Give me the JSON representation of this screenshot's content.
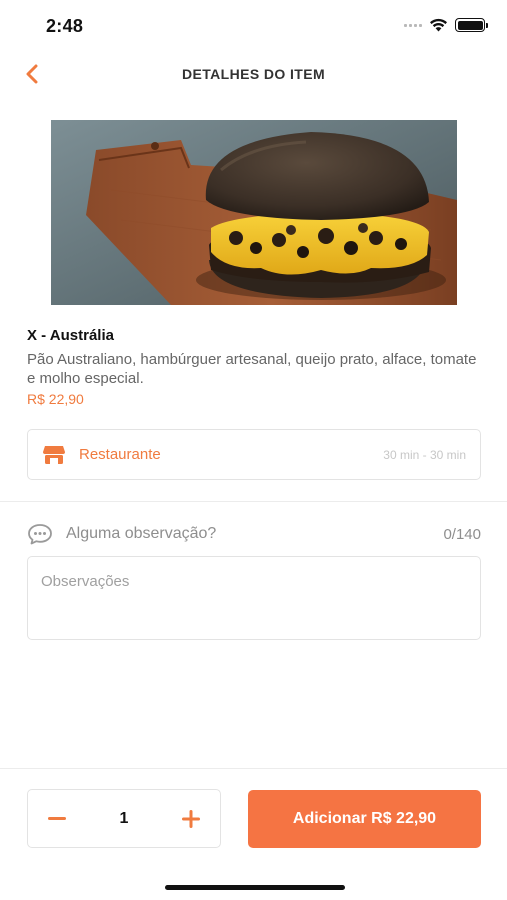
{
  "status_bar": {
    "time": "2:48"
  },
  "header": {
    "title": "DETALHES DO ITEM",
    "back_icon": "chevron-left-icon"
  },
  "item": {
    "image_alt": "X - Austrália",
    "name": "X - Austrália",
    "description": "Pão Australiano, hambúrguer artesanal, queijo prato, alface, tomate e molho especial.",
    "price": "R$ 22,90"
  },
  "restaurant": {
    "icon": "store-icon",
    "label": "Restaurante",
    "delivery_time": "30 min - 30 min"
  },
  "observations": {
    "icon": "chat-bubble-icon",
    "question": "Alguma observação?",
    "counter": "0/140",
    "placeholder": "Observações",
    "value": ""
  },
  "footer": {
    "quantity": "1",
    "minus_icon": "minus-icon",
    "plus_icon": "plus-icon",
    "add_button_label": "Adicionar R$ 22,90"
  },
  "colors": {
    "accent": "#f07b3f",
    "button": "#f57443",
    "border": "#e3e3e3",
    "muted_text": "#8e8e8e"
  }
}
